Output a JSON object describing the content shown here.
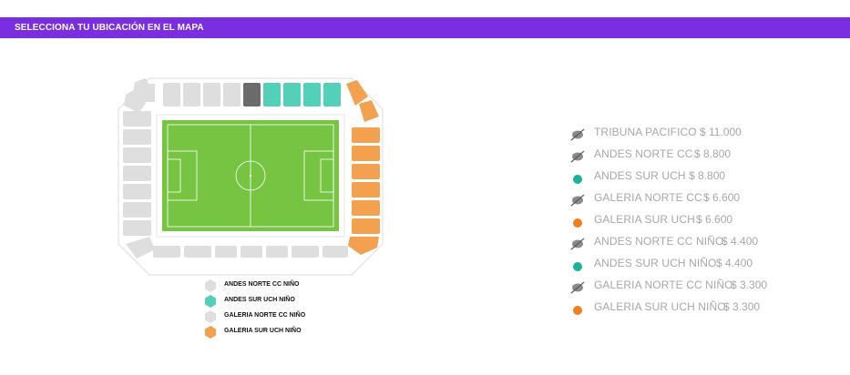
{
  "header": {
    "title": "SELECCIONA TU UBICACIÓN EN EL MAPA"
  },
  "colors": {
    "accent": "#7a2ee0",
    "grey_section": "#dedede",
    "dark_section": "#6b6b6b",
    "teal_section": "#52d0b8",
    "orange_section": "#f3a04f",
    "pitch": "#76c442",
    "teal_dot": "#1bb39a",
    "orange_dot": "#f3801f"
  },
  "map_legend": [
    {
      "label": "ANDES NORTE CC NIÑO",
      "color": "grey",
      "icon": "hexagon-icon"
    },
    {
      "label": "ANDES SUR UCH NIÑO",
      "color": "teal",
      "icon": "hexagon-icon"
    },
    {
      "label": "GALERIA NORTE CC NIÑO",
      "color": "grey",
      "icon": "hexagon-icon"
    },
    {
      "label": "GALERIA SUR UCH NIÑO",
      "color": "orange",
      "icon": "hexagon-icon"
    }
  ],
  "price_list": [
    {
      "name": "TRIBUNA PACIFICO",
      "price": "$ 11.000",
      "status": "sold-out",
      "icon": "unavailable-icon"
    },
    {
      "name": "ANDES NORTE CC",
      "price": "$ 8.800",
      "status": "sold-out",
      "icon": "unavailable-icon"
    },
    {
      "name": "ANDES SUR UCH",
      "price": "$ 8.800",
      "status": "available",
      "color": "teal",
      "icon": "dot-icon"
    },
    {
      "name": "GALERIA NORTE CC",
      "price": "$ 6.600",
      "status": "sold-out",
      "icon": "unavailable-icon"
    },
    {
      "name": "GALERIA SUR UCH",
      "price": "$ 6.600",
      "status": "available",
      "color": "orange",
      "icon": "dot-icon"
    },
    {
      "name": "ANDES NORTE CC NIÑO",
      "price": "$ 4.400",
      "status": "sold-out",
      "icon": "unavailable-icon"
    },
    {
      "name": "ANDES SUR UCH NIÑO",
      "price": "$ 4.400",
      "status": "available",
      "color": "teal",
      "icon": "dot-icon"
    },
    {
      "name": "GALERIA NORTE CC NIÑO",
      "price": "$ 3.300",
      "status": "sold-out",
      "icon": "unavailable-icon"
    },
    {
      "name": "GALERIA SUR UCH NIÑO",
      "price": "$ 3.300",
      "status": "available",
      "color": "orange",
      "icon": "dot-icon"
    }
  ]
}
